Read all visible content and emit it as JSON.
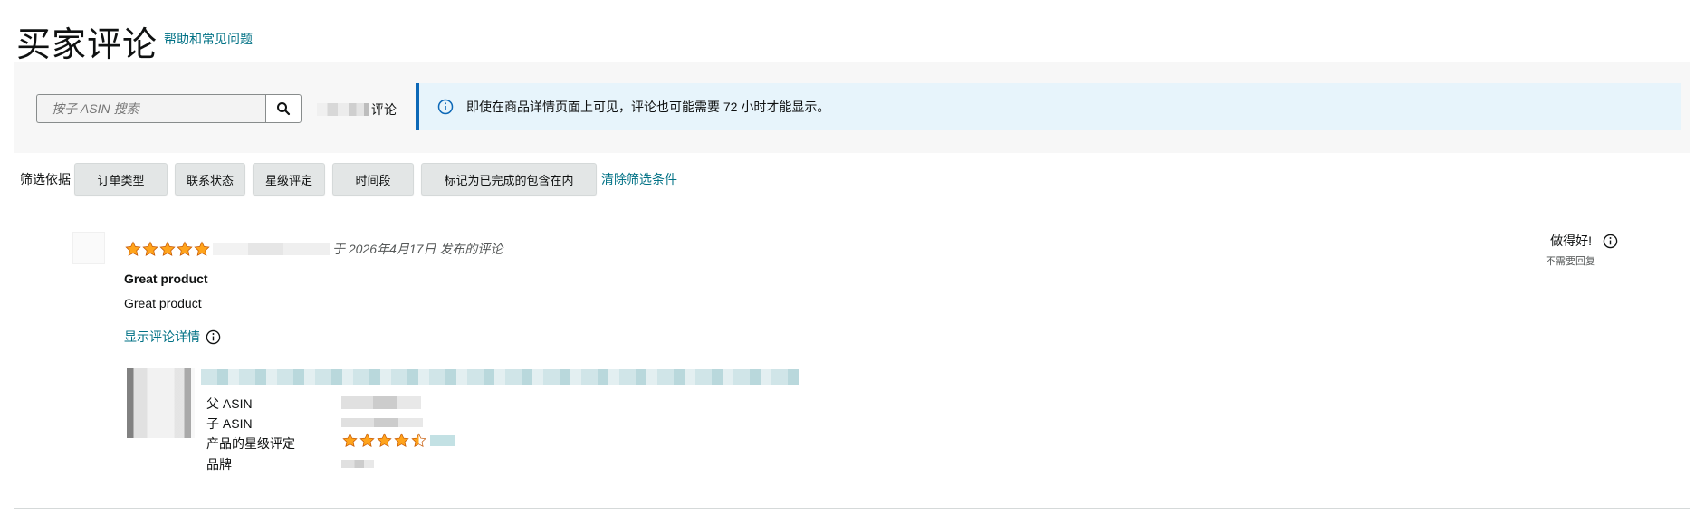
{
  "header": {
    "title": "买家评论",
    "help_link": "帮助和常见问题"
  },
  "search": {
    "placeholder": "按子 ASIN 搜索",
    "button_icon": "search-icon",
    "count_suffix": "评论"
  },
  "notice": {
    "icon": "info-icon",
    "text": "即使在商品详情页面上可见，评论也可能需要 72 小时才能显示。"
  },
  "filters": {
    "label": "筛选依据",
    "buttons": [
      "订单类型",
      "联系状态",
      "星级评定",
      "时间段",
      "标记为已完成的包含在内"
    ],
    "clear_label": "清除筛选条件"
  },
  "review": {
    "rating": 5,
    "posted_text": "于 2026年4月17日 发布的评论",
    "title": "Great product",
    "body": "Great product",
    "details_link": "显示评论详情",
    "status_label": "做得好!",
    "status_sub": "不需要回复",
    "product": {
      "attr_labels": [
        "父 ASIN",
        "子 ASIN",
        "产品的星级评定",
        "品牌"
      ],
      "rating": 4.5
    }
  },
  "colors": {
    "link": "#007185",
    "star": "#ffa41c",
    "notice_bg": "#e7f4fb",
    "notice_border": "#0c68b7"
  }
}
